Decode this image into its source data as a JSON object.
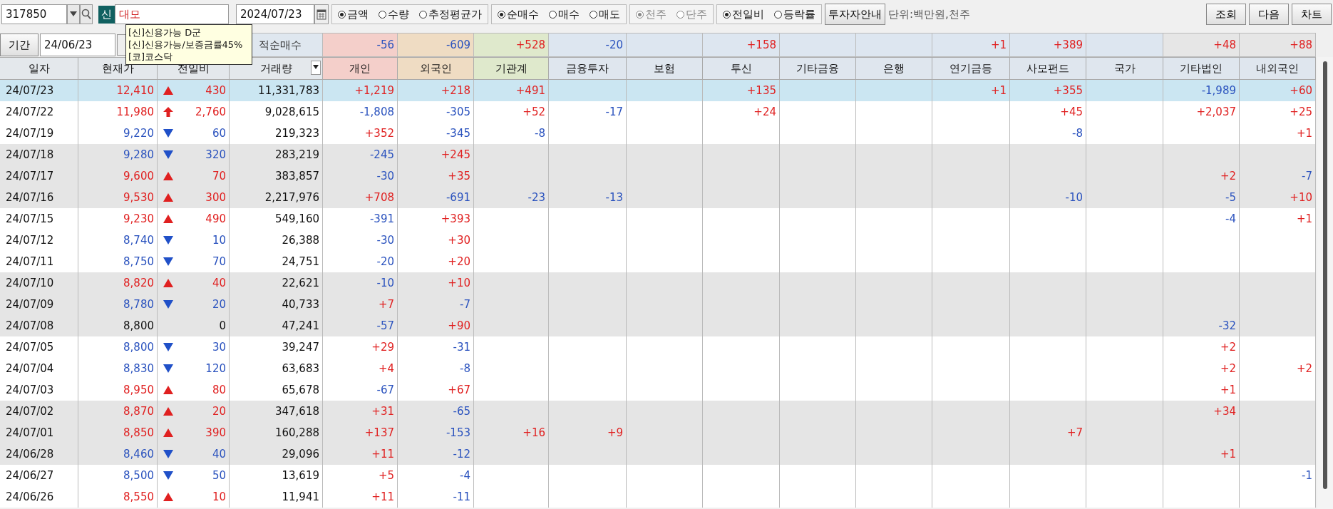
{
  "toolbar": {
    "code": "317850",
    "badge": "신",
    "name": "대모",
    "date": "2024/07/23",
    "radio_groups": [
      {
        "disabled": false,
        "options": [
          {
            "label": "금액",
            "selected": true
          },
          {
            "label": "수량",
            "selected": false
          },
          {
            "label": "추정평균가",
            "selected": false
          }
        ]
      },
      {
        "disabled": false,
        "options": [
          {
            "label": "순매수",
            "selected": true
          },
          {
            "label": "매수",
            "selected": false
          },
          {
            "label": "매도",
            "selected": false
          }
        ]
      },
      {
        "disabled": true,
        "options": [
          {
            "label": "천주",
            "selected": true
          },
          {
            "label": "단주",
            "selected": false
          }
        ]
      },
      {
        "disabled": false,
        "options": [
          {
            "label": "전일비",
            "selected": true
          },
          {
            "label": "등락률",
            "selected": false
          }
        ]
      }
    ],
    "guide_button": "투자자안내",
    "unit": "단위:백만원,천주",
    "buttons": [
      "조회",
      "다음",
      "차트"
    ]
  },
  "tooltip": {
    "lines": [
      "[신]신용가능 D군",
      "[신]신용가능/보증금률45%",
      "[코]코스닥"
    ]
  },
  "period": {
    "label": "기간",
    "date": "24/06/23"
  },
  "summary": {
    "label": "적순매수",
    "values": {
      "individual": "-56",
      "foreign": "-609",
      "institution": "+528",
      "financial_investment": "-20",
      "investment_trust": "+158",
      "pension": "+1",
      "private_fund": "+389",
      "other_corporation": "+48",
      "other_foreign": "+88"
    }
  },
  "columns": [
    "일자",
    "현재가",
    "전일비",
    "거래량",
    "개인",
    "외국인",
    "기관계",
    "금융투자",
    "보험",
    "투신",
    "기타금융",
    "은행",
    "연기금등",
    "사모펀드",
    "국가",
    "기타법인",
    "내외국인"
  ],
  "rows": [
    {
      "date": "24/07/23",
      "price": "12,410",
      "kind": "up",
      "change": "430",
      "volume": "11,331,783",
      "selected": true,
      "investors": {
        "individual": "+1,219",
        "foreign": "+218",
        "institution": "+491",
        "investment_trust": "+135",
        "pension": "+1",
        "private_fund": "+355",
        "other_corporation": "-1,989",
        "other_foreign": "+60"
      }
    },
    {
      "date": "24/07/22",
      "price": "11,980",
      "kind": "limit_up",
      "change": "2,760",
      "volume": "9,028,615",
      "selected": false,
      "investors": {
        "individual": "-1,808",
        "foreign": "-305",
        "institution": "+52",
        "financial_investment": "-17",
        "investment_trust": "+24",
        "private_fund": "+45",
        "other_corporation": "+2,037",
        "other_foreign": "+25"
      }
    },
    {
      "date": "24/07/19",
      "price": "9,220",
      "kind": "down",
      "change": "60",
      "volume": "219,323",
      "selected": false,
      "investors": {
        "individual": "+352",
        "foreign": "-345",
        "institution": "-8",
        "private_fund": "-8",
        "other_foreign": "+1"
      }
    },
    {
      "date": "24/07/18",
      "price": "9,280",
      "kind": "down",
      "change": "320",
      "volume": "283,219",
      "selected": false,
      "investors": {
        "individual": "-245",
        "foreign": "+245"
      }
    },
    {
      "date": "24/07/17",
      "price": "9,600",
      "kind": "up",
      "change": "70",
      "volume": "383,857",
      "selected": false,
      "investors": {
        "individual": "-30",
        "foreign": "+35",
        "other_corporation": "+2",
        "other_foreign": "-7"
      }
    },
    {
      "date": "24/07/16",
      "price": "9,530",
      "kind": "up",
      "change": "300",
      "volume": "2,217,976",
      "selected": false,
      "investors": {
        "individual": "+708",
        "foreign": "-691",
        "institution": "-23",
        "financial_investment": "-13",
        "private_fund": "-10",
        "other_corporation": "-5",
        "other_foreign": "+10"
      }
    },
    {
      "date": "24/07/15",
      "price": "9,230",
      "kind": "up",
      "change": "490",
      "volume": "549,160",
      "selected": false,
      "investors": {
        "individual": "-391",
        "foreign": "+393",
        "other_corporation": "-4",
        "other_foreign": "+1"
      }
    },
    {
      "date": "24/07/12",
      "price": "8,740",
      "kind": "down",
      "change": "10",
      "volume": "26,388",
      "selected": false,
      "investors": {
        "individual": "-30",
        "foreign": "+30"
      }
    },
    {
      "date": "24/07/11",
      "price": "8,750",
      "kind": "down",
      "change": "70",
      "volume": "24,751",
      "selected": false,
      "investors": {
        "individual": "-20",
        "foreign": "+20"
      }
    },
    {
      "date": "24/07/10",
      "price": "8,820",
      "kind": "up",
      "change": "40",
      "volume": "22,621",
      "selected": false,
      "investors": {
        "individual": "-10",
        "foreign": "+10"
      }
    },
    {
      "date": "24/07/09",
      "price": "8,780",
      "kind": "down",
      "change": "20",
      "volume": "40,733",
      "selected": false,
      "investors": {
        "individual": "+7",
        "foreign": "-7"
      }
    },
    {
      "date": "24/07/08",
      "price": "8,800",
      "kind": "flat",
      "change": "0",
      "volume": "47,241",
      "selected": false,
      "investors": {
        "individual": "-57",
        "foreign": "+90",
        "other_corporation": "-32"
      }
    },
    {
      "date": "24/07/05",
      "price": "8,800",
      "kind": "down",
      "change": "30",
      "volume": "39,247",
      "selected": false,
      "investors": {
        "individual": "+29",
        "foreign": "-31",
        "other_corporation": "+2"
      }
    },
    {
      "date": "24/07/04",
      "price": "8,830",
      "kind": "down",
      "change": "120",
      "volume": "63,683",
      "selected": false,
      "investors": {
        "individual": "+4",
        "foreign": "-8",
        "other_corporation": "+2",
        "other_foreign": "+2"
      }
    },
    {
      "date": "24/07/03",
      "price": "8,950",
      "kind": "up",
      "change": "80",
      "volume": "65,678",
      "selected": false,
      "investors": {
        "individual": "-67",
        "foreign": "+67",
        "other_corporation": "+1"
      }
    },
    {
      "date": "24/07/02",
      "price": "8,870",
      "kind": "up",
      "change": "20",
      "volume": "347,618",
      "selected": false,
      "investors": {
        "individual": "+31",
        "foreign": "-65",
        "other_corporation": "+34"
      }
    },
    {
      "date": "24/07/01",
      "price": "8,850",
      "kind": "up",
      "change": "390",
      "volume": "160,288",
      "selected": false,
      "investors": {
        "individual": "+137",
        "foreign": "-153",
        "institution": "+16",
        "financial_investment": "+9",
        "private_fund": "+7"
      }
    },
    {
      "date": "24/06/28",
      "price": "8,460",
      "kind": "down",
      "change": "40",
      "volume": "29,096",
      "selected": false,
      "investors": {
        "individual": "+11",
        "foreign": "-12",
        "other_corporation": "+1"
      }
    },
    {
      "date": "24/06/27",
      "price": "8,500",
      "kind": "down",
      "change": "50",
      "volume": "13,619",
      "selected": false,
      "investors": {
        "individual": "+5",
        "foreign": "-4",
        "other_foreign": "-1"
      }
    },
    {
      "date": "24/06/26",
      "price": "8,550",
      "kind": "up",
      "change": "10",
      "volume": "11,941",
      "selected": false,
      "investors": {
        "individual": "+11",
        "foreign": "-11"
      }
    }
  ]
}
